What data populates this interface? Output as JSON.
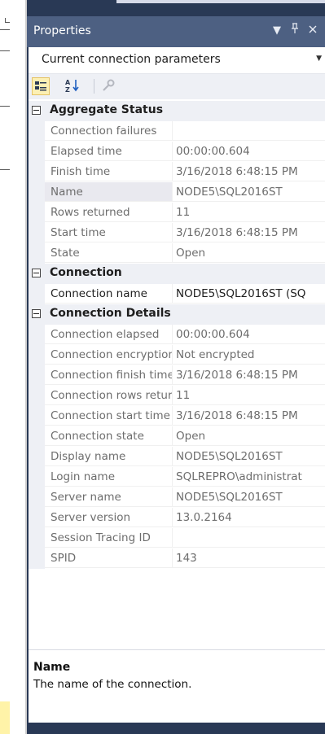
{
  "window": {
    "title": "Properties"
  },
  "titlebar_icons": [
    "dropdown-arrow-icon",
    "pin-icon",
    "close-icon"
  ],
  "combo": {
    "value": "Current connection parameters"
  },
  "toolbar": {
    "tools": [
      "categorized-icon",
      "alphabetical-icon",
      "property-pages-icon"
    ]
  },
  "grid": {
    "categories": [
      {
        "label": "Aggregate Status",
        "rows": [
          {
            "name": "Connection failures",
            "value": ""
          },
          {
            "name": "Elapsed time",
            "value": "00:00:00.604"
          },
          {
            "name": "Finish time",
            "value": "3/16/2018 6:48:15 PM"
          },
          {
            "name": "Name",
            "value": "NODE5\\SQL2016ST"
          },
          {
            "name": "Rows returned",
            "value": "11"
          },
          {
            "name": "Start time",
            "value": "3/16/2018 6:48:15 PM"
          },
          {
            "name": "State",
            "value": "Open"
          }
        ]
      },
      {
        "label": "Connection",
        "rows": [
          {
            "name": "Connection name",
            "value": "NODE5\\SQL2016ST (SQ"
          }
        ]
      },
      {
        "label": "Connection Details",
        "rows": [
          {
            "name": "Connection elapsed",
            "value": "00:00:00.604"
          },
          {
            "name": "Connection encryption",
            "value": "Not encrypted"
          },
          {
            "name": "Connection finish time",
            "value": "3/16/2018 6:48:15 PM"
          },
          {
            "name": "Connection rows returned",
            "value": "11"
          },
          {
            "name": "Connection start time",
            "value": "3/16/2018 6:48:15 PM"
          },
          {
            "name": "Connection state",
            "value": "Open"
          },
          {
            "name": "Display name",
            "value": "NODE5\\SQL2016ST"
          },
          {
            "name": "Login name",
            "value": "SQLREPRO\\administrat"
          },
          {
            "name": "Server name",
            "value": "NODE5\\SQL2016ST"
          },
          {
            "name": "Server version",
            "value": "13.0.2164"
          },
          {
            "name": "Session Tracing ID",
            "value": ""
          },
          {
            "name": "SPID",
            "value": "143"
          }
        ]
      }
    ]
  },
  "description": {
    "title": "Name",
    "text": "The name of the connection."
  },
  "colors": {
    "titlebar": "#4d6082",
    "frame": "#293955",
    "category_bg": "#eef0f5",
    "selected_tool": "#fcf0b4"
  }
}
